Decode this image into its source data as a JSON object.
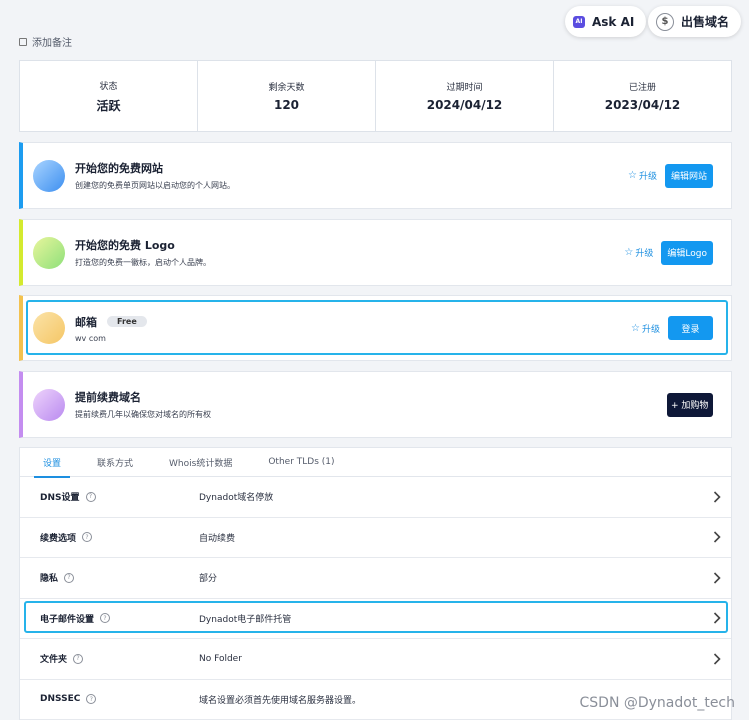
{
  "header": {
    "ask_ai_label": "Ask AI",
    "sell_domain_label": "出售域名",
    "add_note_label": "添加备注"
  },
  "stats": [
    {
      "label": "状态",
      "value": "活跃"
    },
    {
      "label": "剩余天数",
      "value": "120"
    },
    {
      "label": "过期时间",
      "value": "2024/04/12"
    },
    {
      "label": "已注册",
      "value": "2023/04/12"
    }
  ],
  "cards": {
    "website": {
      "title": "开始您的免费网站",
      "subtitle": "创建您的免费单页网站以启动您的个人网站。",
      "upgrade_label": "升级",
      "button_label": "编辑网站",
      "accent": "#1c9cf0"
    },
    "logo": {
      "title": "开始您的免费 Logo",
      "subtitle": "打造您的免费一徽标，启动个人品牌。",
      "upgrade_label": "升级",
      "button_label": "编辑Logo",
      "accent": "#d4ea2e"
    },
    "email": {
      "title": "邮箱",
      "badge": "Free",
      "subtitle": "wv          com",
      "upgrade_label": "升级",
      "button_label": "登录",
      "accent": "#f3c24f"
    },
    "renew": {
      "title": "提前续费域名",
      "subtitle": "提前续费几年以确保您对域名的所有权",
      "button_label": "+ 加购物",
      "accent": "#c48df0"
    }
  },
  "tabs": [
    {
      "label": "设置",
      "active": true
    },
    {
      "label": "联系方式",
      "active": false
    },
    {
      "label": "Whois统计数据",
      "active": false
    },
    {
      "label": "Other TLDs (1)",
      "active": false
    }
  ],
  "settings": [
    {
      "key": "DNS设置",
      "value": "Dynadot域名停放"
    },
    {
      "key": "续费选项",
      "value": "自动续费"
    },
    {
      "key": "隐私",
      "value": "部分"
    },
    {
      "key": "电子邮件设置",
      "value": "Dynadot电子邮件托管"
    },
    {
      "key": "文件夹",
      "value": "No Folder"
    },
    {
      "key": "DNSSEC",
      "value": "域名设置必须首先使用域名服务器设置。"
    }
  ],
  "watermark": "CSDN @Dynadot_tech",
  "colors": {
    "accent_blue": "#1398f0",
    "highlight": "#26b3ea",
    "dark_button": "#0e1838"
  }
}
